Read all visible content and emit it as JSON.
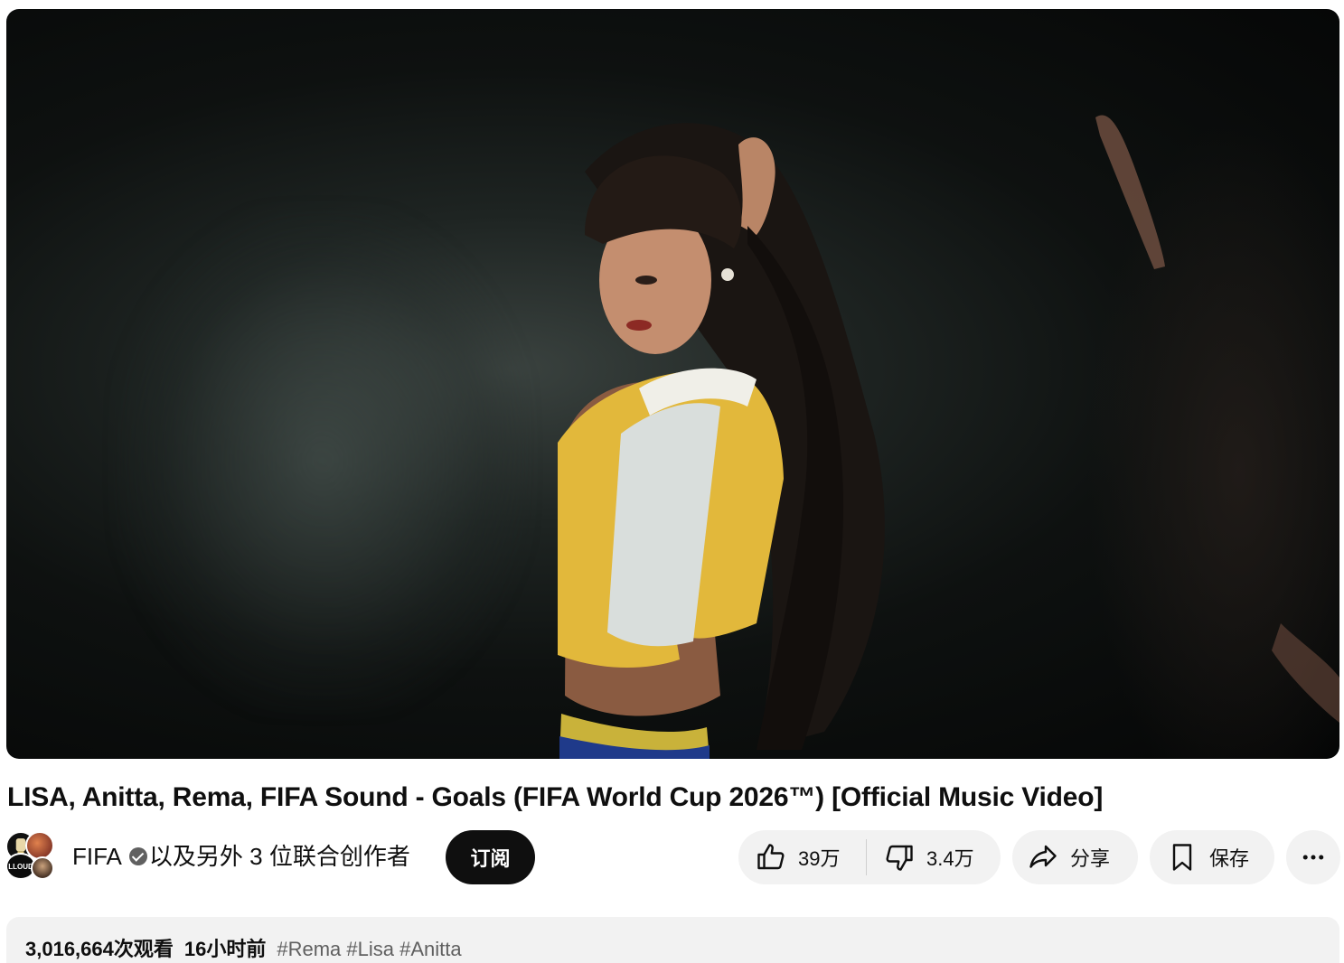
{
  "video": {
    "title": "LISA, Anitta, Rema, FIFA Sound - Goals (FIFA World Cup 2026™) [Official Music Video]"
  },
  "channel": {
    "name": "FIFA",
    "collab_text": "以及另外 3 位联合创作者",
    "avatar_label": "LLOUD",
    "subscribe_label": "订阅"
  },
  "actions": {
    "like_count": "39万",
    "dislike_count": "3.4万",
    "share_label": "分享",
    "save_label": "保存"
  },
  "description": {
    "views": "3,016,664次观看",
    "posted": "16小时前",
    "tags": [
      "#Rema",
      "#Lisa",
      "#Anitta"
    ]
  },
  "icons": {
    "like": "thumbs-up-icon",
    "dislike": "thumbs-down-icon",
    "share": "share-arrow-icon",
    "save": "bookmark-icon",
    "more": "more-horizontal-icon",
    "verified": "verified-check-icon"
  },
  "colors": {
    "pill_bg": "#f2f2f2",
    "subscribe_bg": "#0f0f0f",
    "tag_color": "#606060"
  }
}
